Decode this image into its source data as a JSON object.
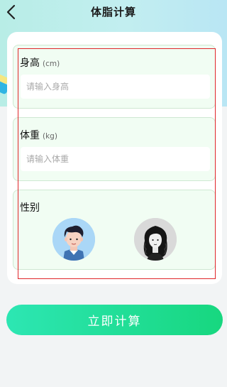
{
  "header": {
    "title": "体脂计算",
    "back_icon": "chevron-left-icon"
  },
  "form": {
    "height": {
      "label": "身高",
      "unit": "(cm)",
      "placeholder": "请输入身高",
      "value": ""
    },
    "weight": {
      "label": "体重",
      "unit": "(kg)",
      "placeholder": "请输入体重",
      "value": ""
    },
    "gender": {
      "label": "性别",
      "options": [
        {
          "name": "male",
          "icon": "male-avatar-icon"
        },
        {
          "name": "female",
          "icon": "female-avatar-icon"
        }
      ]
    }
  },
  "submit": {
    "label": "立即计算"
  },
  "colors": {
    "accent_start": "#2de6b3",
    "accent_end": "#17d77f",
    "section_bg": "#f1fdf3",
    "highlight": "#e0262a"
  }
}
